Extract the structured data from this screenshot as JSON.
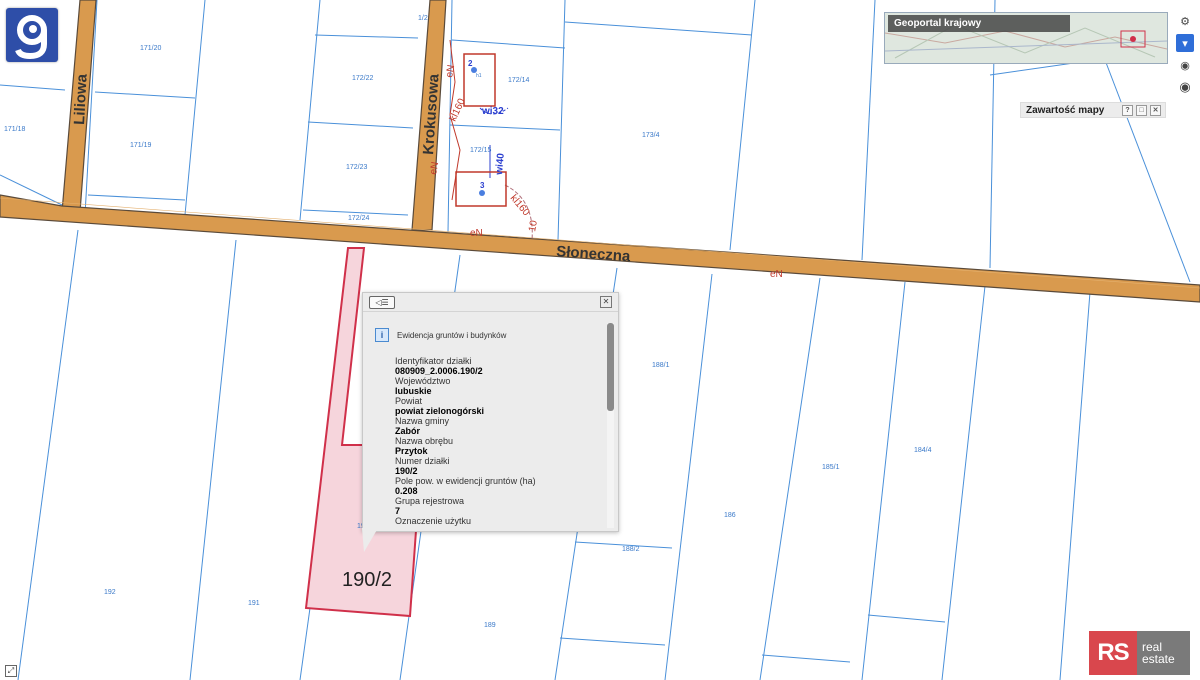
{
  "streets": {
    "liliowa": "Liliowa",
    "krokusowa": "Krokusowa",
    "sloneczna": "Słoneczna"
  },
  "parcels": {
    "p171_20": "171/20",
    "p171_18": "171/18",
    "p171_19": "171/19",
    "p172_22": "172/22",
    "p172_23": "172/23",
    "p172_24": "172/24",
    "p172_14": "172/14",
    "p172_15": "172/15",
    "p173_4": "173/4",
    "p188_1": "188/1",
    "p188_2": "188/2",
    "p185_1": "185/1",
    "p184_4": "184/4",
    "p186": "186",
    "p189": "189",
    "p191": "191",
    "p192": "192",
    "p190_2_small": "190/2",
    "p1_2": "1/2"
  },
  "selected_parcel_label": "190/2",
  "utility_labels": {
    "en1": "eN",
    "en2": "eN",
    "en3": "eN",
    "en4": "eN",
    "kl160_a": "kl160",
    "kl160_b": "kl160",
    "wi32": "wi32",
    "wi40": "wi40",
    "ten": "10",
    "b2": "2",
    "b3": "3",
    "hl": "h1"
  },
  "logo": {
    "icon": "geoportal-g-logo",
    "color": "#2e4ea8"
  },
  "overview": {
    "title": "Geoportal krajowy"
  },
  "map_contents": {
    "title": "Zawartość mapy",
    "help": "?",
    "restore": "□",
    "close": "✕"
  },
  "tools": {
    "settings_icon": "gear-icon",
    "layers_icon": "layers-icon",
    "eye_small_icon": "eye-icon",
    "eye_large_icon": "eye-icon"
  },
  "popup": {
    "back_icon": "list-back-icon",
    "close": "✕",
    "section_title": "Ewidencja gruntów i budynków",
    "info_glyph": "i",
    "fields": [
      {
        "label": "Identyfikator działki",
        "value": "080909_2.0006.190/2"
      },
      {
        "label": "Województwo",
        "value": "lubuskie"
      },
      {
        "label": "Powiat",
        "value": "powiat zielonogórski"
      },
      {
        "label": "Nazwa gminy",
        "value": "Zabór"
      },
      {
        "label": "Nazwa obrębu",
        "value": "Przytok"
      },
      {
        "label": "Numer działki",
        "value": "190/2"
      },
      {
        "label": "Pole pow. w ewidencji gruntów (ha)",
        "value": "0.208"
      },
      {
        "label": "Grupa rejestrowa",
        "value": "7"
      },
      {
        "label": "Oznaczenie użytku",
        "value": ""
      }
    ]
  },
  "watermark": {
    "rs": "RS",
    "line1": "real",
    "line2": "estate"
  },
  "colors": {
    "road": "#d99a4e",
    "road_border": "#5a4a3a",
    "parcel_line": "#4a90d9",
    "selected_fill": "#f6d5dc",
    "selected_stroke": "#d0304a",
    "utility_red": "#c0392b"
  }
}
